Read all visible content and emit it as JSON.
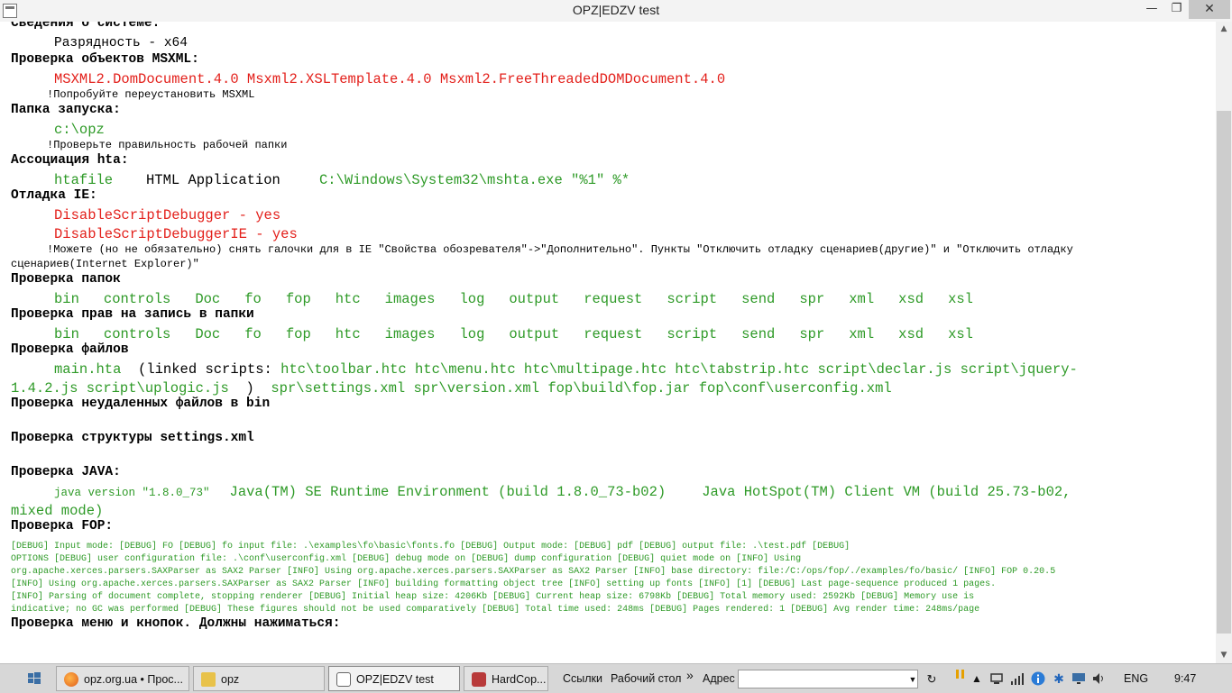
{
  "window": {
    "title": "OPZ|EDZV test",
    "minimize_glyph": "—",
    "maximize_glyph": "❐",
    "close_glyph": "✕"
  },
  "report": {
    "sys_title": "Сведения о системе:",
    "sys_bitness": "Разрядность - x64",
    "msxml_title": "Проверка объектов MSXML:",
    "msxml_value": "MSXML2.DomDocument.4.0 Msxml2.XSLTemplate.4.0 Msxml2.FreeThreadedDOMDocument.4.0",
    "msxml_note": "!Попробуйте переустановить MSXML",
    "startup_title": "Папка запуска:",
    "startup_value": "c:\\opz",
    "startup_note": "!Проверьте правильность рабочей папки",
    "hta_title": "Ассоциация hta:",
    "hta_type": "htafile",
    "hta_name": "HTML Application",
    "hta_cmd": "C:\\Windows\\System32\\mshta.exe \"%1\" %*",
    "ie_title": "Отладка IE:",
    "ie_line1": "DisableScriptDebugger - yes",
    "ie_line2": "DisableScriptDebuggerIE - yes",
    "ie_note1": "!Можете (но не обязательно) снять галочки для в IE \"Свойства обозревателя\"->\"Дополнительно\". Пункты \"Отключить отладку сценариев(другие)\" и \"Отключить отладку",
    "ie_note2": "сценариев(Internet Explorer)\"",
    "folders_title": "Проверка папок",
    "folders": [
      "bin",
      "controls",
      "Doc",
      "fo",
      "fop",
      "htc",
      "images",
      "log",
      "output",
      "request",
      "script",
      "send",
      "spr",
      "xml",
      "xsd",
      "xsl"
    ],
    "rights_title": "Проверка прав на запись в папки",
    "files_title": "Проверка файлов",
    "files_line1": "main.hta",
    "files_linked_label": "(linked scripts:",
    "files_line1_scripts": "htc\\toolbar.htc  htc\\menu.htc  htc\\multipage.htc  htc\\tabstrip.htc  script\\declar.js  script\\jquery-",
    "files_line2_scripts": "1.4.2.js  script\\uplogic.js",
    "files_close_paren": ")",
    "files_line2_rest": "spr\\settings.xml   spr\\version.xml   fop\\build\\fop.jar   fop\\conf\\userconfig.xml",
    "bin_title": "Проверка неудаленных файлов в bin",
    "settings_title": "Проверка структуры settings.xml",
    "java_title": "Проверка JAVA:",
    "java_version": "java version \"1.8.0_73\"",
    "java_runtime": "Java(TM) SE Runtime Environment (build 1.8.0_73-b02)",
    "java_vm": "Java HotSpot(TM) Client VM (build 25.73-b02,",
    "java_vm2": "mixed mode)",
    "fop_title": "Проверка FOP:",
    "fop_lines": [
      "     [DEBUG] Input mode:         [DEBUG] FO          [DEBUG] fo input file: .\\examples\\fo\\basic\\fonts.fo          [DEBUG] Output mode:          [DEBUG] pdf          [DEBUG] output file: .\\test.pdf          [DEBUG]",
      "OPTIONS          [DEBUG] user configuration file: .\\conf\\userconfig.xml          [DEBUG] debug mode on          [DEBUG] dump configuration          [DEBUG] quiet mode on          [INFO] Using",
      "org.apache.xerces.parsers.SAXParser as SAX2 Parser          [INFO] Using org.apache.xerces.parsers.SAXParser as SAX2 Parser          [INFO] base directory: file:/C:/ops/fop/./examples/fo/basic/          [INFO] FOP 0.20.5",
      "[INFO] Using org.apache.xerces.parsers.SAXParser as SAX2 Parser          [INFO] building formatting object tree          [INFO] setting up fonts          [INFO] [1]          [DEBUG] Last page-sequence produced 1 pages.",
      "[INFO] Parsing of document complete, stopping renderer          [DEBUG] Initial heap size: 4206Kb          [DEBUG] Current heap size: 6798Kb          [DEBUG] Total memory used: 2592Kb          [DEBUG] Memory use is",
      "indicative; no GC was performed          [DEBUG] These figures should not be used comparatively          [DEBUG] Total time used: 248ms          [DEBUG] Pages rendered: 1          [DEBUG] Avg render time: 248ms/page"
    ],
    "menu_title": "Проверка меню и кнопок. Должны нажиматься:"
  },
  "colors": {
    "error": "#e3201b",
    "ok": "#2e9a27"
  },
  "taskbar": {
    "start_icon": "windows-logo-icon",
    "apps": [
      {
        "label": "opz.org.ua • Прос...",
        "icon": "firefox-icon"
      },
      {
        "label": "opz",
        "icon": "folder-icon"
      },
      {
        "label": "OPZ|EDZV test",
        "icon": "window-icon"
      },
      {
        "label": "HardCop...",
        "icon": "app-icon"
      }
    ],
    "links_label": "Ссылки",
    "desktop_label": "Рабочий стол",
    "more_glyph": "»",
    "address_label": "Адрес",
    "address_value": "",
    "lang": "ENG",
    "clock": "9:47"
  }
}
